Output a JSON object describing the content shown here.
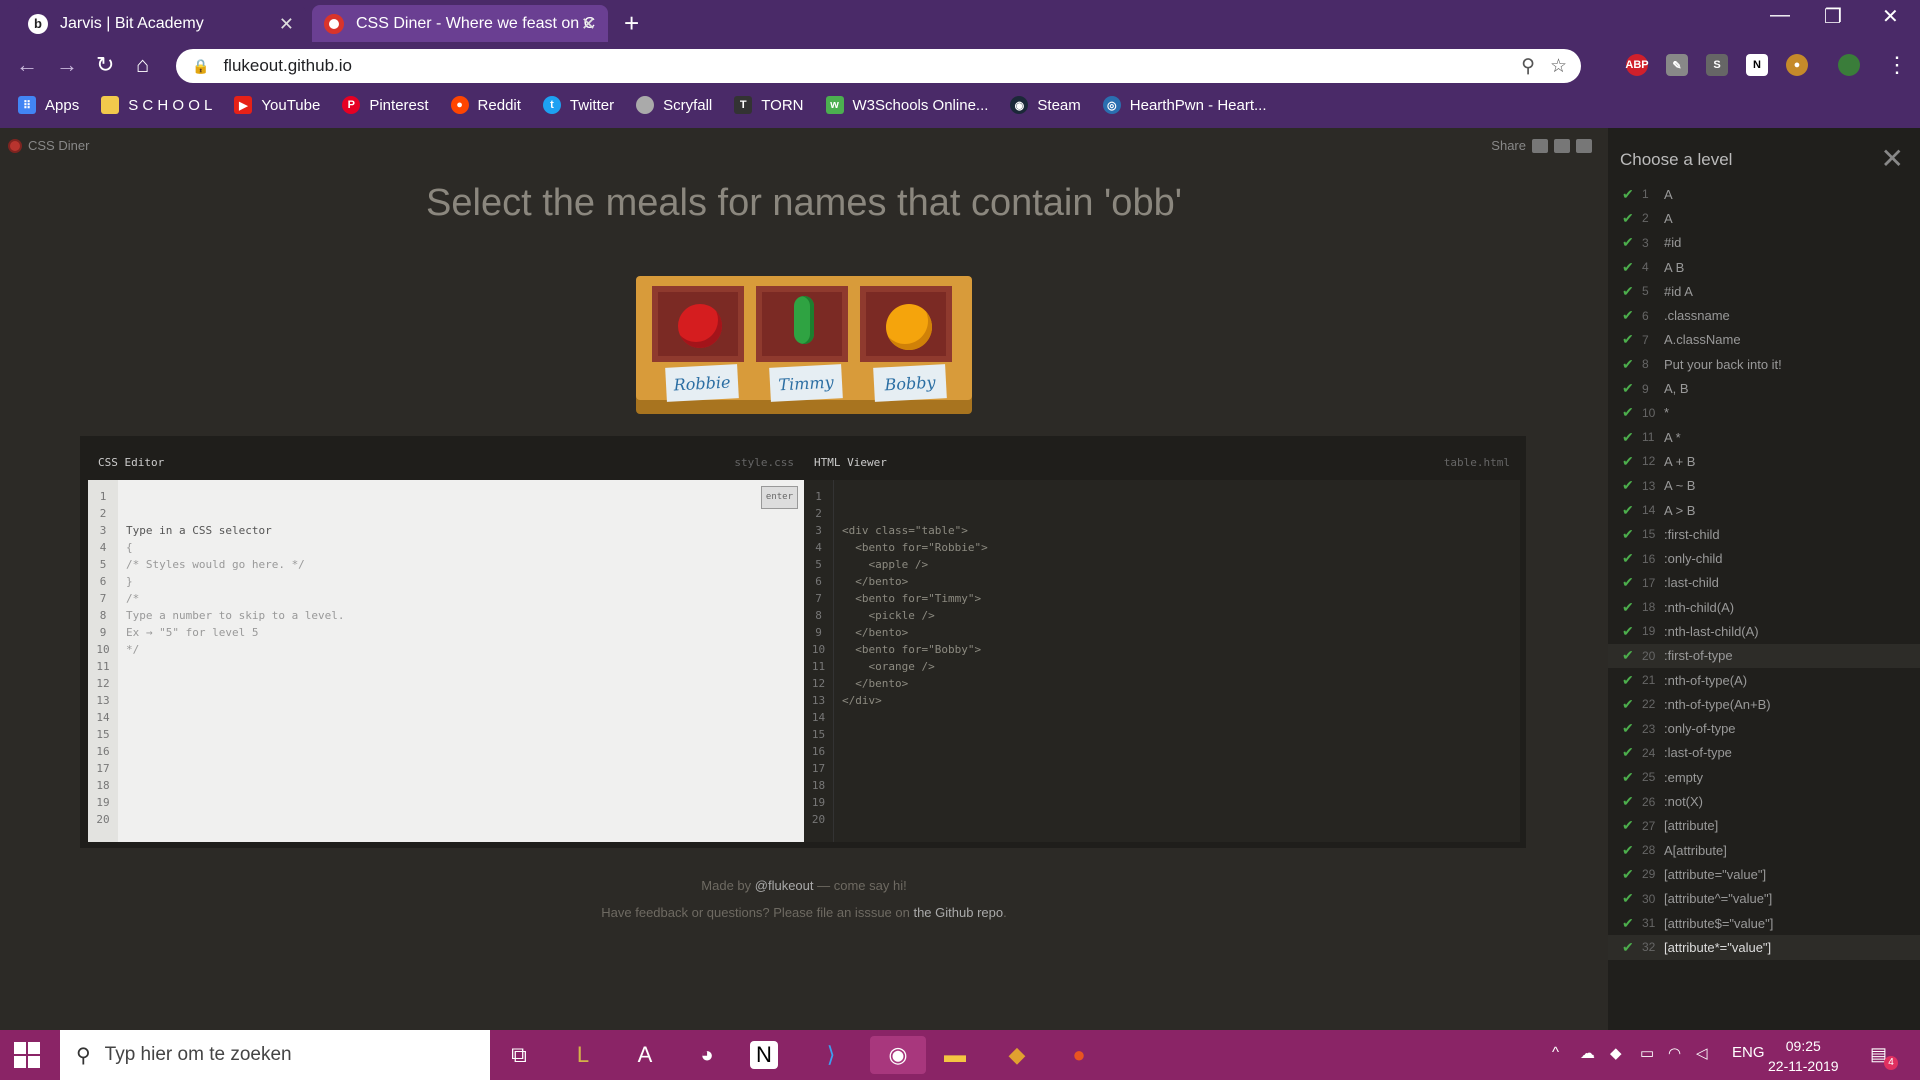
{
  "browser": {
    "tabs": [
      {
        "title": "Jarvis | Bit Academy",
        "favicon": "b"
      },
      {
        "title": "CSS Diner - Where we feast on C",
        "favicon": ""
      }
    ],
    "url": "flukeout.github.io",
    "bookmarks": [
      "Apps",
      "S C H O O L",
      "YouTube",
      "Pinterest",
      "Reddit",
      "Twitter",
      "Scryfall",
      "TORN",
      "W3Schools Online...",
      "Steam",
      "HearthPwn - Heart..."
    ],
    "extensions": [
      "ABP",
      "S"
    ]
  },
  "page": {
    "brand": "CSS Diner",
    "share": "Share",
    "instruction": "Select the meals for names that contain 'obb'",
    "plates": [
      {
        "name": "Robbie",
        "food": "apple"
      },
      {
        "name": "Timmy",
        "food": "pickle"
      },
      {
        "name": "Bobby",
        "food": "orange"
      }
    ],
    "css_editor": {
      "title": "CSS Editor",
      "file": "style.css",
      "enter": "enter",
      "lines": [
        "Type in a CSS selector",
        "{",
        "/* Styles would go here. */",
        "}",
        "",
        "/*",
        "Type a number to skip to a level.",
        "Ex → \"5\" for level 5",
        "*/"
      ]
    },
    "html_viewer": {
      "title": "HTML Viewer",
      "file": "table.html",
      "lines": [
        "<div class=\"table\">",
        "  <bento for=\"Robbie\">",
        "    <apple />",
        "  </bento>",
        "  <bento for=\"Timmy\">",
        "    <pickle />",
        "  </bento>",
        "  <bento for=\"Bobby\">",
        "    <orange />",
        "  </bento>",
        "</div>"
      ]
    },
    "footer_line1_pre": "Made by ",
    "footer_line1_link": "@flukeout",
    "footer_line1_post": " — come say hi!",
    "footer_line2_pre": "Have feedback or questions? Please file an isssue on ",
    "footer_line2_link": "the Github repo",
    "footer_line2_post": "."
  },
  "levels": {
    "title": "Choose a level",
    "items": [
      "A",
      "A",
      "#id",
      "A B",
      "#id A",
      ".classname",
      "A.className",
      "Put your back into it!",
      "A, B",
      "*",
      "A *",
      "A + B",
      "A ~ B",
      "A > B",
      ":first-child",
      ":only-child",
      ":last-child",
      ":nth-child(A)",
      ":nth-last-child(A)",
      ":first-of-type",
      ":nth-of-type(A)",
      ":nth-of-type(An+B)",
      ":only-of-type",
      ":last-of-type",
      ":empty",
      ":not(X)",
      "[attribute]",
      "A[attribute]",
      "[attribute=\"value\"]",
      "[attribute^=\"value\"]",
      "[attribute$=\"value\"]",
      "[attribute*=\"value\"]"
    ],
    "hover_level": 20,
    "current_level": 32
  },
  "taskbar": {
    "search_placeholder": "Typ hier om te zoeken",
    "lang": "ENG",
    "time": "09:25",
    "date": "22-11-2019",
    "notifications": "4"
  },
  "colors": {
    "accent": "#4a2a68",
    "taskbar": "#8a2466",
    "check": "#4cae4c",
    "table": "#d89b3a"
  }
}
